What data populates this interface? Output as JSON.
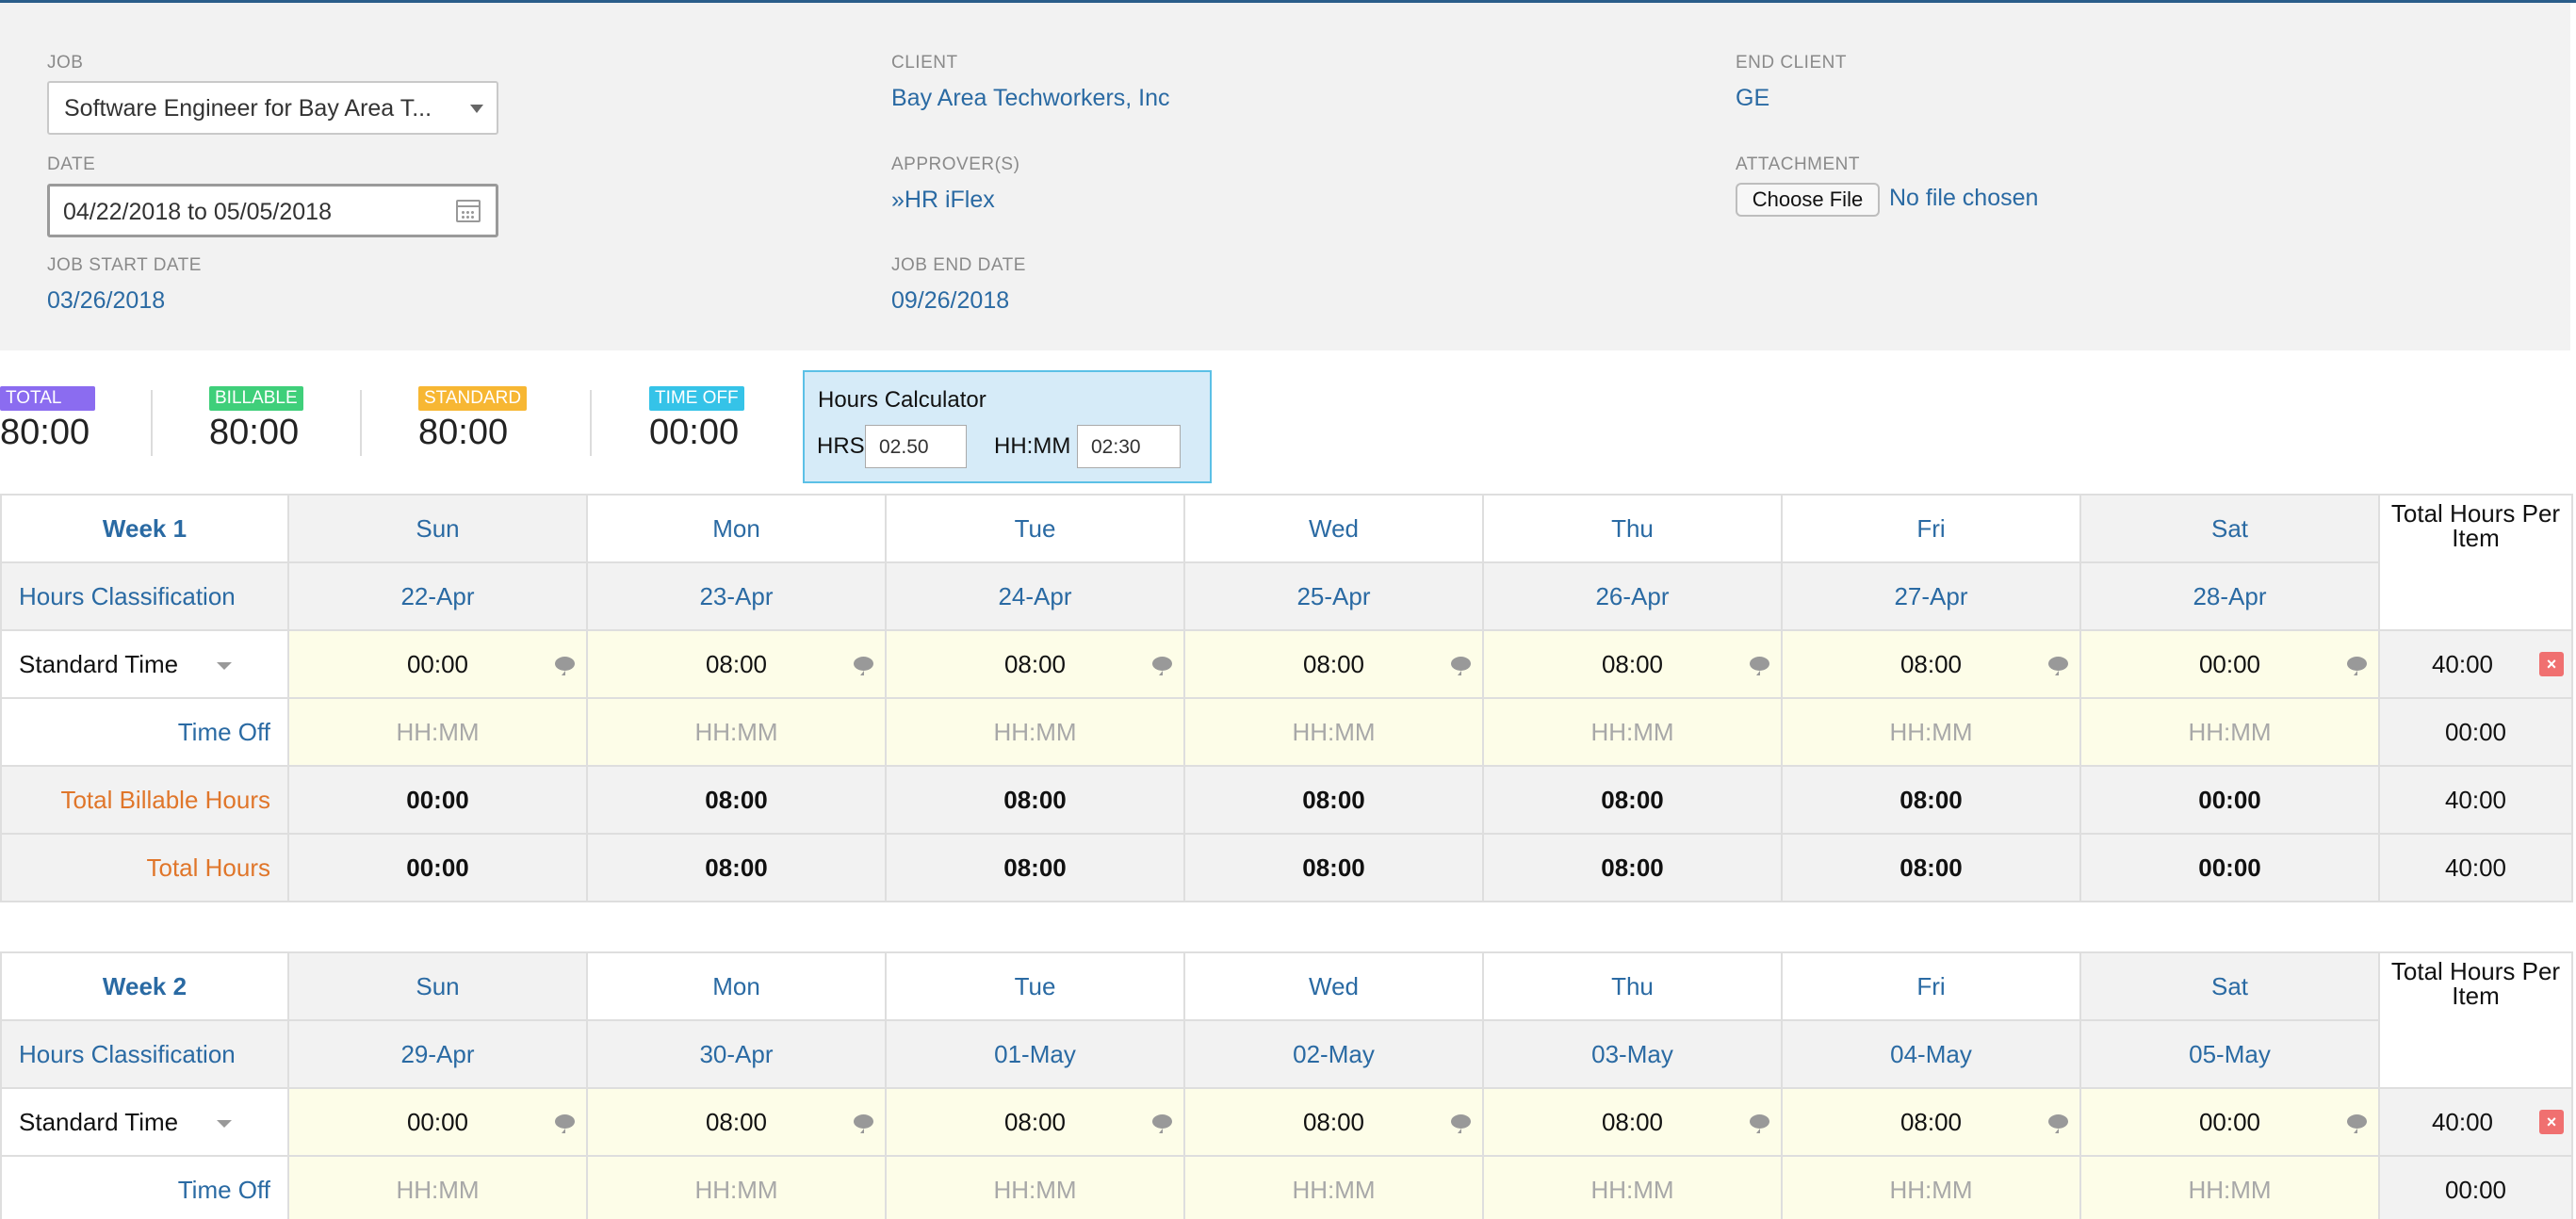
{
  "colors": {
    "accent": "#2a6aa3",
    "total": "#8b6cf0",
    "billable": "#3fcf7a",
    "standard": "#f7b733",
    "time_off": "#35c3e8",
    "orange": "#e0762a",
    "entry_bg": "#fdfde8"
  },
  "job": {
    "label": "JOB",
    "value": "Software Engineer for Bay Area T..."
  },
  "date": {
    "label": "DATE",
    "value": "04/22/2018 to 05/05/2018"
  },
  "job_start": {
    "label": "JOB START DATE",
    "value": "03/26/2018"
  },
  "client": {
    "label": "CLIENT",
    "value": "Bay Area Techworkers, Inc"
  },
  "approvers": {
    "label": "APPROVER(S)",
    "value": "»HR iFlex"
  },
  "job_end": {
    "label": "JOB END DATE",
    "value": "09/26/2018"
  },
  "end_client": {
    "label": "END CLIENT",
    "value": "GE"
  },
  "attachment": {
    "label": "ATTACHMENT",
    "button": "Choose File",
    "status": "No file chosen"
  },
  "summary": {
    "total": {
      "label": "TOTAL",
      "value": "80:00"
    },
    "billable": {
      "label": "BILLABLE",
      "value": "80:00"
    },
    "standard": {
      "label": "STANDARD",
      "value": "80:00"
    },
    "time_off": {
      "label": "TIME OFF",
      "value": "00:00"
    }
  },
  "calculator": {
    "title": "Hours Calculator",
    "hrs_label": "HRS",
    "hrs_value": "02.50",
    "hhmm_label": "HH:MM",
    "hhmm_value": "02:30"
  },
  "weeks": [
    {
      "title": "Week 1",
      "class_header": "Hours Classification",
      "days": [
        "Sun",
        "Mon",
        "Tue",
        "Wed",
        "Thu",
        "Fri",
        "Sat"
      ],
      "dates": [
        "22-Apr",
        "23-Apr",
        "24-Apr",
        "25-Apr",
        "26-Apr",
        "27-Apr",
        "28-Apr"
      ],
      "total_header": "Total Hours Per Item",
      "standard": {
        "label": "Standard Time",
        "values": [
          "00:00",
          "08:00",
          "08:00",
          "08:00",
          "08:00",
          "08:00",
          "00:00"
        ],
        "total": "40:00"
      },
      "time_off": {
        "label": "Time Off",
        "placeholder": "HH:MM",
        "total": "00:00"
      },
      "billable": {
        "label": "Total Billable Hours",
        "values": [
          "00:00",
          "08:00",
          "08:00",
          "08:00",
          "08:00",
          "08:00",
          "00:00"
        ],
        "total": "40:00"
      },
      "totals": {
        "label": "Total Hours",
        "values": [
          "00:00",
          "08:00",
          "08:00",
          "08:00",
          "08:00",
          "08:00",
          "00:00"
        ],
        "total": "40:00"
      }
    },
    {
      "title": "Week 2",
      "class_header": "Hours Classification",
      "days": [
        "Sun",
        "Mon",
        "Tue",
        "Wed",
        "Thu",
        "Fri",
        "Sat"
      ],
      "dates": [
        "29-Apr",
        "30-Apr",
        "01-May",
        "02-May",
        "03-May",
        "04-May",
        "05-May"
      ],
      "total_header": "Total Hours Per Item",
      "standard": {
        "label": "Standard Time",
        "values": [
          "00:00",
          "08:00",
          "08:00",
          "08:00",
          "08:00",
          "08:00",
          "00:00"
        ],
        "total": "40:00"
      },
      "time_off": {
        "label": "Time Off",
        "placeholder": "HH:MM",
        "total": "00:00"
      }
    }
  ]
}
